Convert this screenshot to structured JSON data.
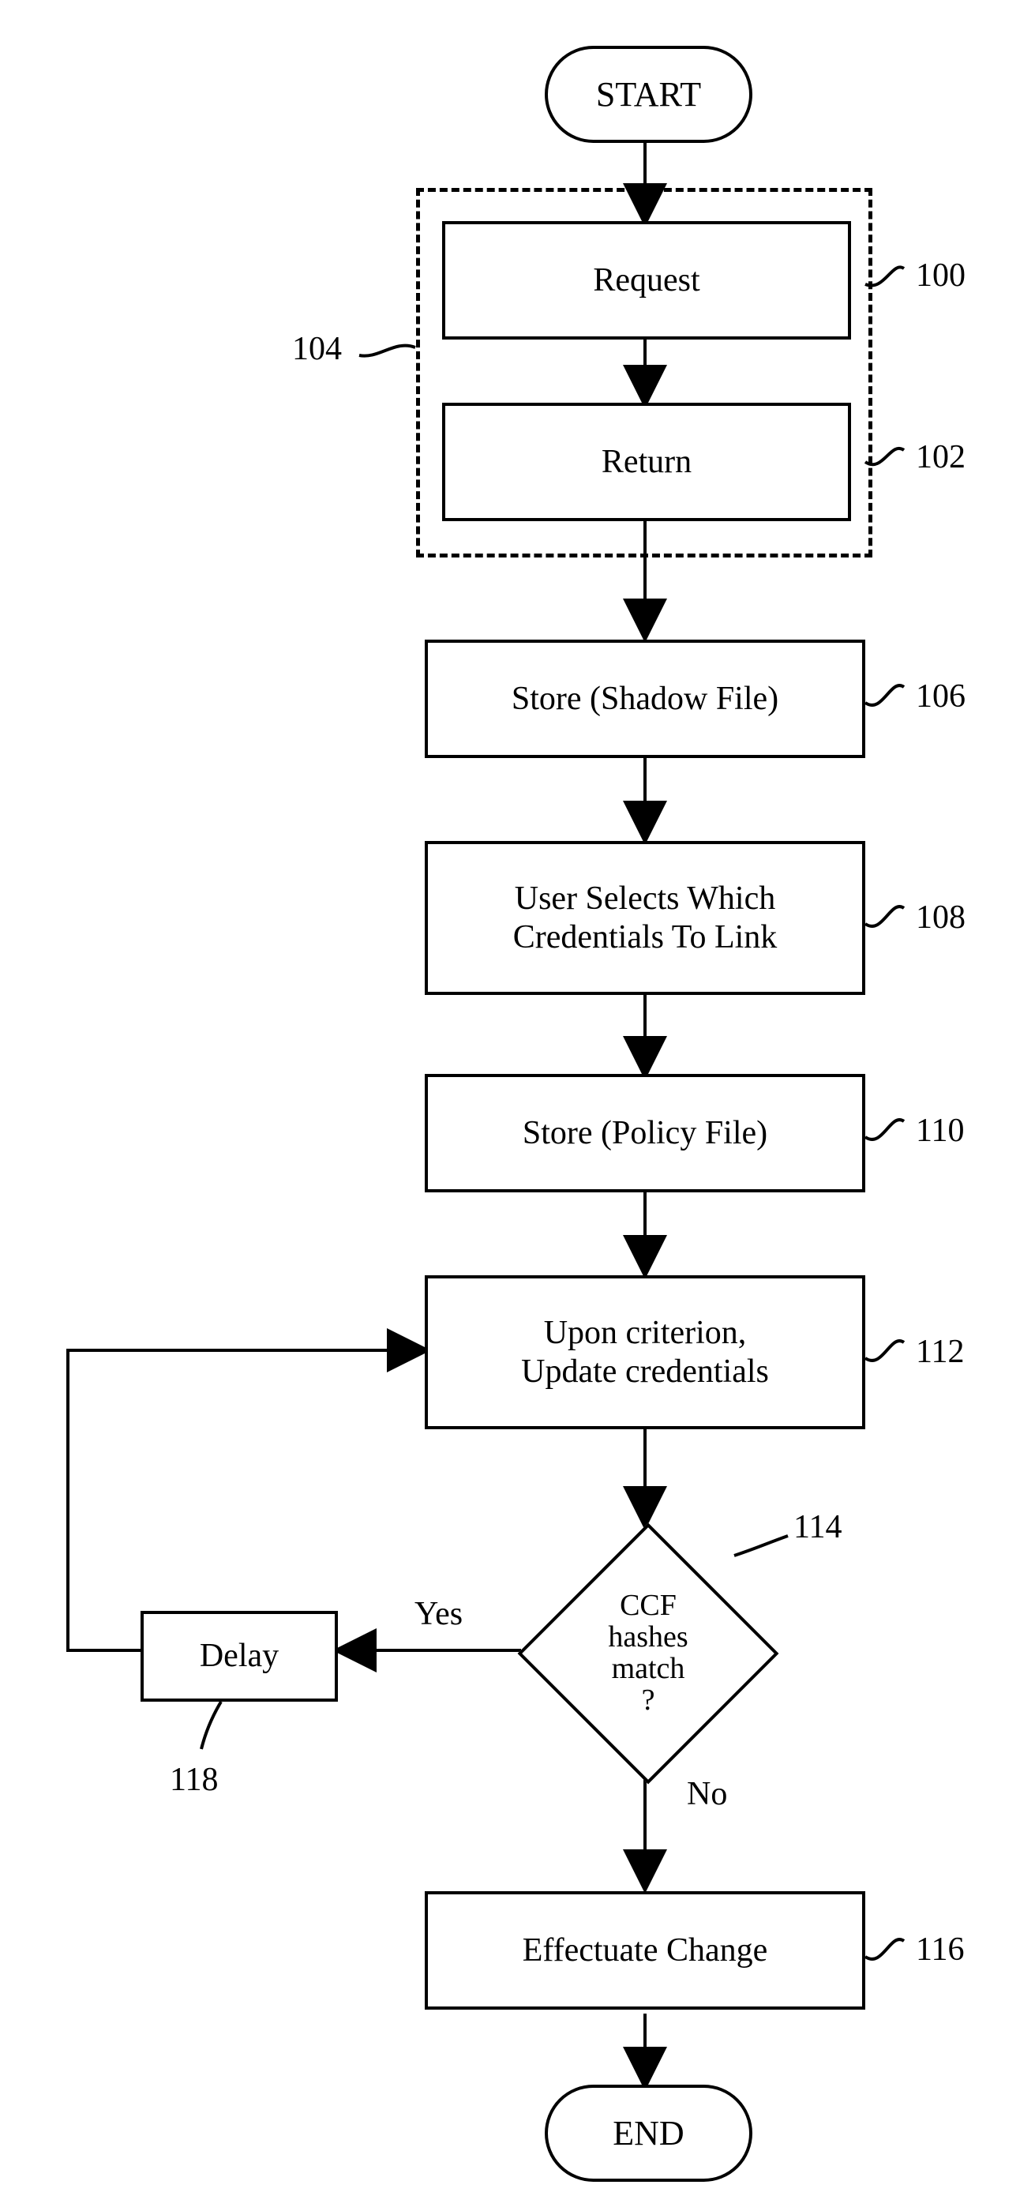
{
  "terminators": {
    "start": "START",
    "end": "END"
  },
  "blocks": {
    "request": "Request",
    "return": "Return",
    "store_shadow": "Store (Shadow File)",
    "user_selects": "User Selects Which\nCredentials To Link",
    "store_policy": "Store (Policy File)",
    "update_credentials": "Upon criterion,\nUpdate credentials",
    "effectuate_change": "Effectuate Change",
    "delay": "Delay"
  },
  "decisions": {
    "ccf": "CCF\nhashes\nmatch\n?"
  },
  "branch_labels": {
    "yes": "Yes",
    "no": "No"
  },
  "ref_labels": {
    "100": "100",
    "102": "102",
    "104": "104",
    "106": "106",
    "108": "108",
    "110": "110",
    "112": "112",
    "114": "114",
    "116": "116",
    "118": "118"
  }
}
